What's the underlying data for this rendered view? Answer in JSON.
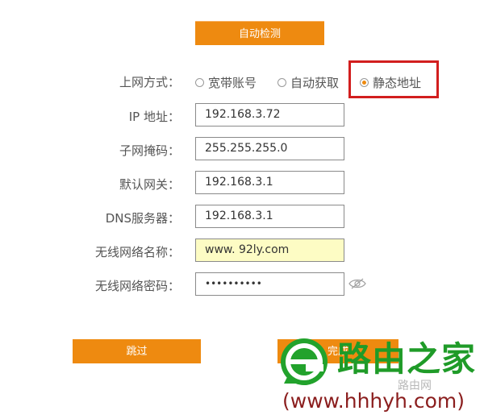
{
  "buttons": {
    "auto_detect": "自动检测",
    "skip": "跳过",
    "finish": "完成"
  },
  "connection": {
    "label": "上网方式：",
    "options": [
      "宽带账号",
      "自动获取",
      "静态地址"
    ],
    "selected": "静态地址"
  },
  "fields": {
    "ip": {
      "label": "IP 地址：",
      "value": "192.168.3.72"
    },
    "subnet": {
      "label": "子网掩码：",
      "value": "255.255.255.0"
    },
    "gateway": {
      "label": "默认网关：",
      "value": "192.168.3.1"
    },
    "dns": {
      "label": "DNS服务器：",
      "value": "192.168.3.1"
    },
    "ssid": {
      "label": "无线网络名称：",
      "value": "www. 92ly.com"
    },
    "wifi_password": {
      "label": "无线网络密码：",
      "value": "••••••••••"
    }
  },
  "watermark": {
    "brand": "路由之家",
    "url": "(www.hhhyh.com)",
    "faint": "路由网"
  },
  "colors": {
    "accent": "#ee8a10",
    "highlight": "#d21e1e",
    "watermark_green": "#1f9b28",
    "watermark_url": "#8b1e1e",
    "ssid_bg": "#fdfcc4"
  },
  "icons": {
    "password_toggle": "eye-icon",
    "watermark_logo": "e-logo-icon"
  }
}
